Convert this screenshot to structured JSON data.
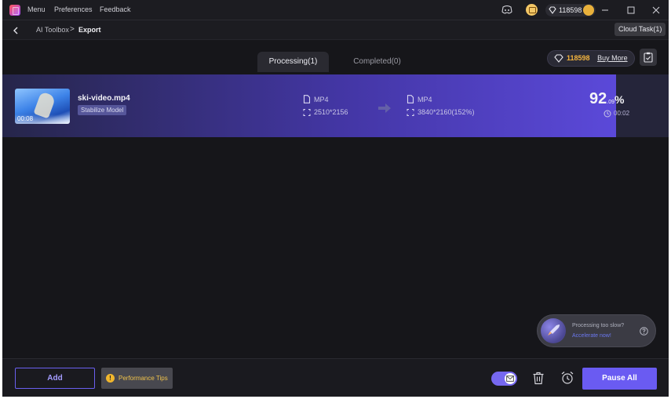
{
  "titlebar": {
    "menus": [
      "Menu",
      "Preferences",
      "Feedback"
    ],
    "credits": "118598",
    "icons": [
      "app-logo-icon",
      "discord-icon",
      "store-icon",
      "diamond-icon",
      "avatar-icon",
      "minimize-icon",
      "maximize-icon",
      "close-icon"
    ]
  },
  "breadcrumb": {
    "root": "AI Toolbox",
    "separator": ">",
    "current": "Export",
    "cloud_task_label": "Cloud Task(1)"
  },
  "tabs": [
    {
      "label": "Processing(1)",
      "active": true
    },
    {
      "label": "Completed(0)",
      "active": false
    }
  ],
  "buy": {
    "credits": "118598",
    "link_label": "Buy More"
  },
  "task": {
    "thumb_duration": "00:08",
    "file_name": "ski-video.mp4",
    "model": "Stabilize Model",
    "source": {
      "format": "MP4",
      "resolution": "2510*2156"
    },
    "output": {
      "format": "MP4",
      "resolution": "3840*2160(152%)"
    },
    "progress_int": "92",
    "progress_dec": ".09",
    "progress_sign": "%",
    "progress_fraction": 0.9209,
    "time_left": "00:02"
  },
  "accelerate": {
    "title": "Processing too slow?",
    "link": "Accelerate now!"
  },
  "bottom": {
    "add_label": "Add",
    "perf_tips_label": "Performance Tips",
    "perf_icon": "!",
    "email_notify_on": true,
    "pause_all_label": "Pause All"
  },
  "colors": {
    "accent": "#6a5bf2",
    "credit_gold": "#f4b43e",
    "background": "#16161a"
  }
}
